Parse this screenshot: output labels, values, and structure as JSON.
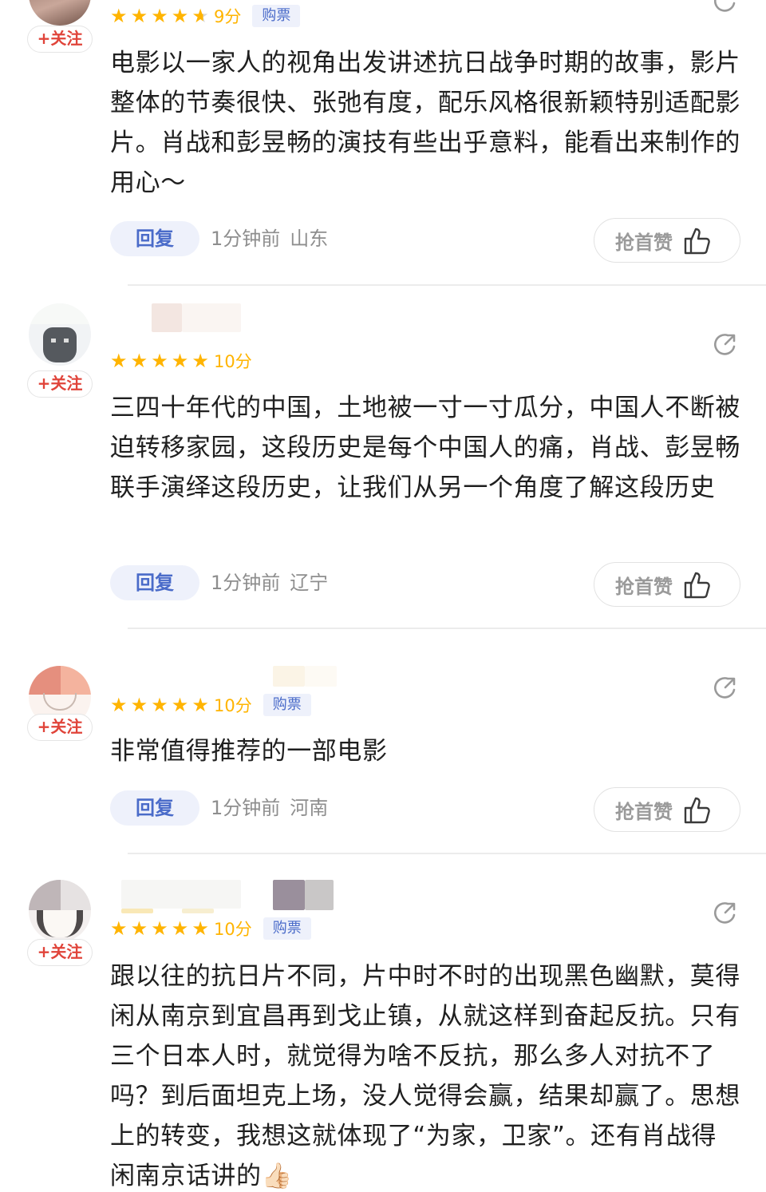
{
  "comments": [
    {
      "follow_label": "+关注",
      "score_text": "9分",
      "tag_label": "购票",
      "content": "电影以一家人的视角出发讲述抗日战争时期的故事，影片整体的节奏很快、张弛有度，配乐风格很新颖特别适配影片。肖战和彭昱畅的演技有些出乎意料，能看出来制作的用心～",
      "reply_label": "回复",
      "time": "1分钟前",
      "location": "山东",
      "like_label": "抢首赞",
      "rating_stars": 4.5
    },
    {
      "follow_label": "+关注",
      "score_text": "10分",
      "tag_label": "",
      "content": "三四十年代的中国，土地被一寸一寸瓜分，中国人不断被迫转移家园，这段历史是每个中国人的痛，肖战、彭昱畅联手演绎这段历史，让我们从另一个角度了解这段历史",
      "reply_label": "回复",
      "time": "1分钟前",
      "location": "辽宁",
      "like_label": "抢首赞",
      "rating_stars": 5
    },
    {
      "follow_label": "+关注",
      "score_text": "10分",
      "tag_label": "购票",
      "content": "非常值得推荐的一部电影",
      "reply_label": "回复",
      "time": "1分钟前",
      "location": "河南",
      "like_label": "抢首赞",
      "rating_stars": 5
    },
    {
      "follow_label": "+关注",
      "score_text": "10分",
      "tag_label": "购票",
      "content": "跟以往的抗日片不同，片中时不时的出现黑色幽默，莫得闲从南京到宜昌再到戈止镇，从就这样到奋起反抗。只有三个日本人时，就觉得为啥不反抗，那么多人对抗不了吗？到后面坦克上场，没人觉得会赢，结果却赢了。思想上的转变，我想这就体现了“为家，卫家”。还有肖战得闲南京话讲的",
      "emoji": "👍🏻",
      "rating_stars": 5
    }
  ],
  "colors": {
    "star": "#ffb400",
    "follow": "#e0443a",
    "reply_bg": "#eef1fb",
    "reply_text": "#4a6bc9",
    "meta": "#8e8e8e"
  },
  "icons": [
    "share-icon",
    "thumbs-up-icon",
    "star-icon"
  ]
}
